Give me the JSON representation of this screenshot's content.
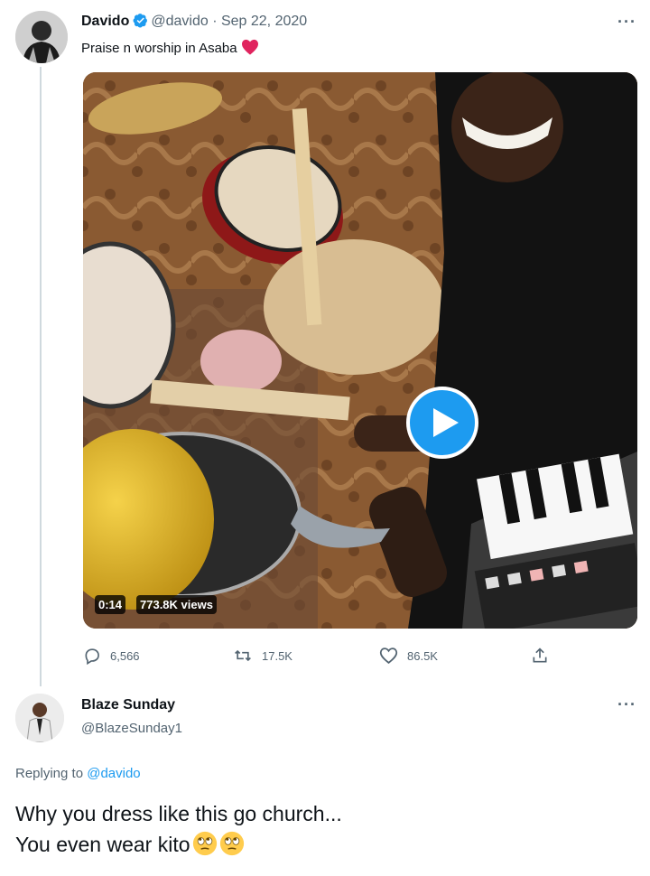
{
  "tweet": {
    "author_name": "Davido",
    "author_handle": "@davido",
    "separator": "·",
    "date": "Sep 22, 2020",
    "text": "Praise n worship in Asaba",
    "video": {
      "duration": "0:14",
      "views": "773.8K views"
    },
    "actions": {
      "replies": "6,566",
      "retweets": "17.5K",
      "likes": "86.5K"
    }
  },
  "reply": {
    "author_name": "Blaze Sunday",
    "author_handle": "@BlazeSunday1",
    "replying_prefix": "Replying to",
    "replying_handle": "@davido",
    "line1": "Why you dress like this go church...",
    "line2": "You even wear kito"
  },
  "colors": {
    "accent": "#1d9bf0",
    "muted": "#536471",
    "heart": "#e0245e"
  },
  "icons": [
    "verified-icon",
    "heart-emoji-icon",
    "more-icon",
    "play-icon",
    "reply-icon",
    "retweet-icon",
    "like-icon",
    "share-icon",
    "eye-roll-emoji-icon"
  ]
}
